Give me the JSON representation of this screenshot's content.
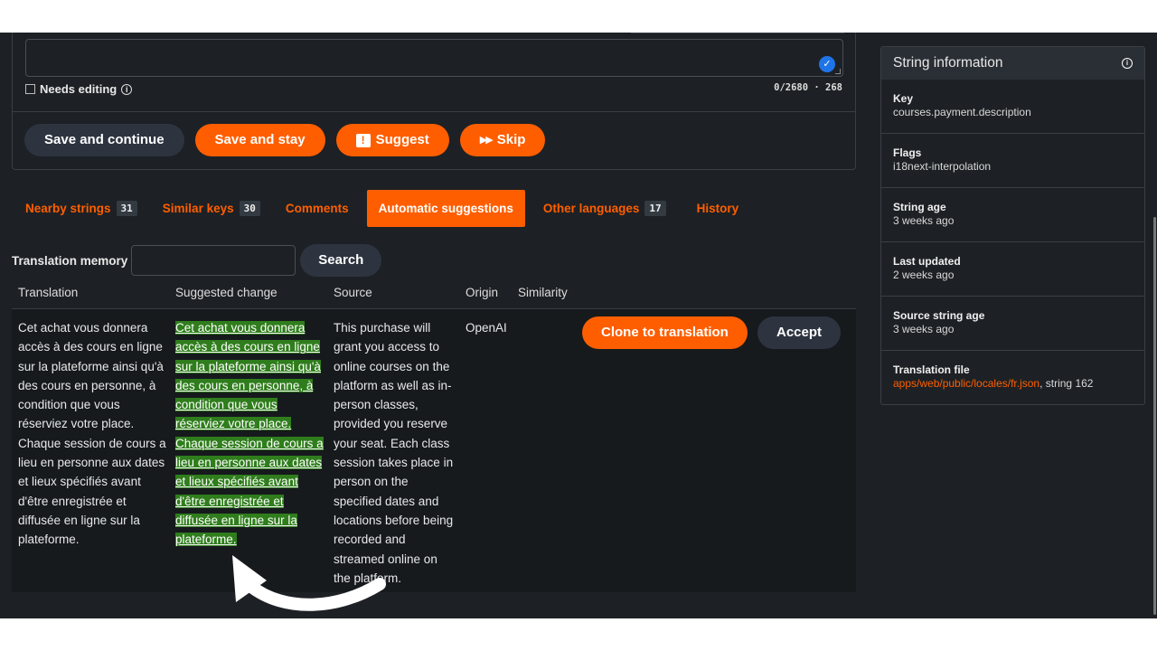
{
  "editor": {
    "needs_editing_label": "Needs editing",
    "counter": "0/2680 · 268",
    "buttons": {
      "save_continue": "Save and continue",
      "save_stay": "Save and stay",
      "suggest": "Suggest",
      "skip": "Skip"
    }
  },
  "tabs": [
    {
      "label": "Nearby strings",
      "count": "31"
    },
    {
      "label": "Similar keys",
      "count": "30"
    },
    {
      "label": "Comments",
      "count": ""
    },
    {
      "label": "Automatic suggestions",
      "count": ""
    },
    {
      "label": "Other languages",
      "count": "17"
    },
    {
      "label": "History",
      "count": ""
    }
  ],
  "active_tab": "Automatic suggestions",
  "tm": {
    "label": "Translation memory",
    "input_value": "",
    "search_label": "Search"
  },
  "table": {
    "headers": [
      "Translation",
      "Suggested change",
      "Source",
      "Origin",
      "Similarity"
    ],
    "row": {
      "translation": "Cet achat vous donnera accès à des cours en ligne sur la plateforme ainsi qu'à des cours en personne, à condition que vous réserviez votre place. Chaque session de cours a lieu en personne aux dates et lieux spécifiés avant d'être enregistrée et diffusée en ligne sur la plateforme.",
      "suggested": "Cet achat vous donnera accès à des cours en ligne sur la plateforme ainsi qu'à des cours en personne, à condition que vous réserviez votre place. Chaque session de cours a lieu en personne aux dates et lieux spécifiés avant d'être enregistrée et diffusée en ligne sur la plateforme.",
      "source": "This purchase will grant you access to online courses on the platform as well as in-person classes, provided you reserve your seat. Each class session takes place in person on the specified dates and locations before being recorded and streamed online on the platform.",
      "origin": "OpenAI",
      "similarity": "",
      "clone_label": "Clone to translation",
      "accept_label": "Accept"
    }
  },
  "sidebar": {
    "title": "String information",
    "items": [
      {
        "label": "Key",
        "value": "courses.payment.description"
      },
      {
        "label": "Flags",
        "value": "i18next-interpolation"
      },
      {
        "label": "String age",
        "value": "3 weeks ago"
      },
      {
        "label": "Last updated",
        "value": "2 weeks ago"
      },
      {
        "label": "Source string age",
        "value": "3 weeks ago"
      },
      {
        "label": "Translation file",
        "link": "apps/web/public/locales/fr.json",
        "suffix": ", string 162"
      }
    ]
  },
  "colors": {
    "accent": "#ff5e00",
    "background": "#1d2125",
    "highlight": "#2f7d1c",
    "dark_button": "#2d3440"
  },
  "icons": [
    "info-icon",
    "check-badge-icon",
    "suggest-icon",
    "skip-icon",
    "curved-arrow-icon"
  ]
}
